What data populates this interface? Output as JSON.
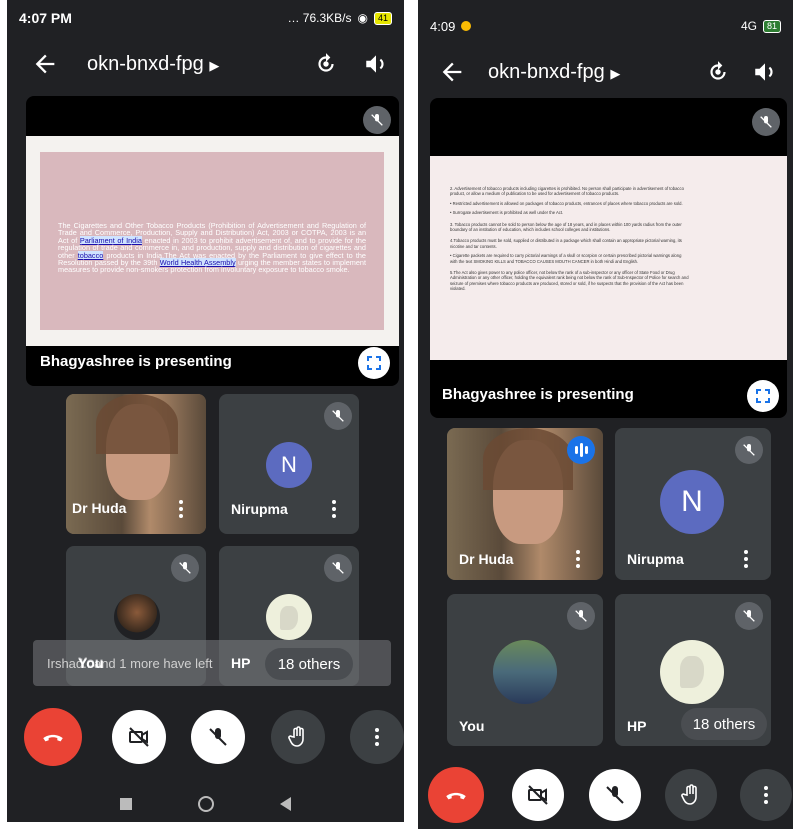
{
  "left": {
    "status": {
      "time": "4:07 PM",
      "net": "… 76.3KB/s",
      "battery": "41"
    },
    "meeting_code": "okn-bnxd-fpg",
    "presenting_label": "Bhagyashree is presenting",
    "slide": {
      "text_before_link1": "The Cigarettes and Other Tobacco Products (Prohibition of Advertisement and Regulation of Trade and Commerce, Production, Supply and Distribution) Act, 2003 or COTPA, 2003 is an Act of ",
      "link1": "Parliament of India",
      "text_mid1": " enacted in 2003 to prohibit advertisement of, and to provide for the regulation of trade and commerce in, and production, supply and distribution of cigarettes and other ",
      "link2": "tobacco",
      "text_mid2": " products in India.The Act was enacted by the Parliament to give effect to the Resolution passed by the 39th ",
      "link3": "World Health Assembly",
      "text_end": " urging the member states to implement measures to provide non-smokers protection from involuntary exposure to tobacco smoke."
    },
    "tiles": [
      {
        "name": "Dr Huda"
      },
      {
        "name": "Nirupma",
        "initial": "N"
      },
      {
        "name": "You"
      },
      {
        "name": "HP"
      }
    ],
    "toast": "Irshad.. and 1 more have left",
    "others": "18 others"
  },
  "right": {
    "status": {
      "time": "4:09",
      "net": "4G",
      "battery": "81"
    },
    "meeting_code": "okn-bnxd-fpg",
    "presenting_label": "Bhagyashree is presenting",
    "slide_lines": [
      "2. Advertisement of tobacco products including cigarettes is prohibited. No person shall participate in advertisement of tobacco",
      "product, or allow a medium of publication to be used for advertisement of tobacco products.",
      "•  Restricted advertisement is allowed on packages of tobacco products, entrances of places where tobacco products are sold.",
      "•  Surrogate advertisement is prohibited as well under the Act.",
      "3. Tobacco products cannot be sold to person below the age of 18 years, and in places within 100 yards radius from the outer",
      "boundary of an institution of education, which includes school colleges and institutions.",
      "4.Tobacco products must be sold, supplied or distributed in a package which shall contain an appropriate pictorial warning, its",
      "nicotine and tar contents.",
      "•  Cigarette packets are required to carry pictorial warnings of a skull or scorpion or certain prescribed pictorial warnings along",
      "with the text SMOKING KILLS and TOBACCO CAUSES MOUTH CANCER in both Hindi and English.",
      "5.The Act also gives power to any police officer, not below the rank of a sub-inspector or any officer of State Food or Drug",
      "Administration or any other officer, holding the equivalent rank being not below the rank of Sub-Inspector of Police for search and",
      "seizure of premises where tobacco products are produced, stored or sold, if he suspects that the provision of the Act has been",
      "violated."
    ],
    "tiles": [
      {
        "name": "Dr Huda"
      },
      {
        "name": "Nirupma",
        "initial": "N"
      },
      {
        "name": "You"
      },
      {
        "name": "HP"
      }
    ],
    "others": "18 others"
  },
  "icons": {
    "back": "arrow-left-icon",
    "caret": "caret-right-icon",
    "switch_camera": "switch-camera-icon",
    "speaker": "speaker-icon",
    "mic_off": "mic-off-icon",
    "expand": "fullscreen-icon",
    "more": "more-vert-icon",
    "end_call": "call-end-icon",
    "camera_off": "camera-off-icon",
    "hand": "raise-hand-icon"
  },
  "colors": {
    "background": "#202124",
    "tile": "#3c4043",
    "end_call": "#ea4335",
    "avatar": "#5c6bc0",
    "slide_left": "#d9b8bd",
    "slide_right": "#f5ecec"
  }
}
